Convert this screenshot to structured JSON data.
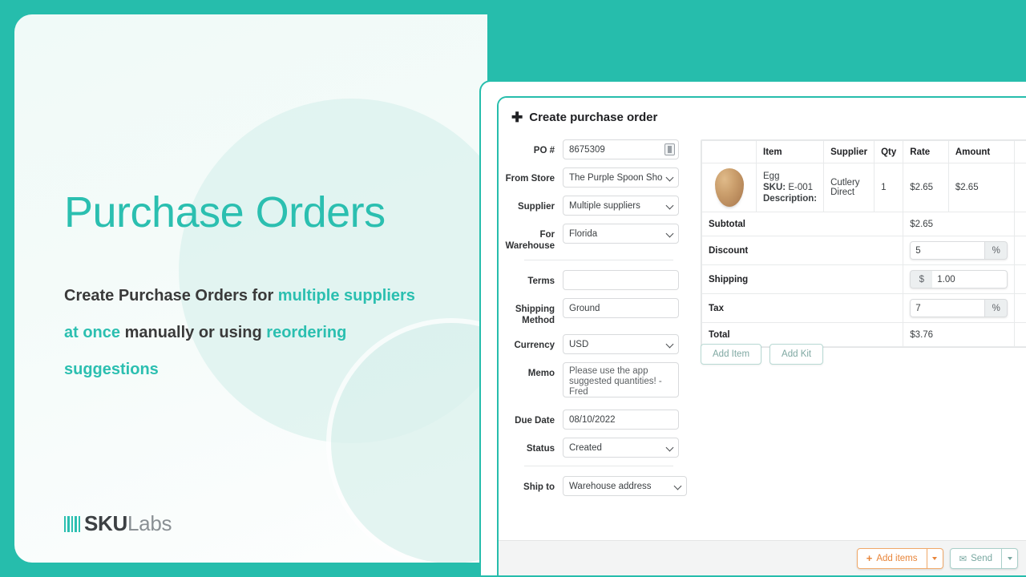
{
  "hero": {
    "title": "Purchase Orders",
    "subtitle_parts": [
      {
        "text": "Create Purchase Orders for ",
        "highlight": false
      },
      {
        "text": "multiple suppliers at once",
        "highlight": true
      },
      {
        "text": " manually or using ",
        "highlight": false
      },
      {
        "text": "reordering suggestions",
        "highlight": true
      }
    ],
    "logo": {
      "bold": "SKU",
      "light": "Labs"
    },
    "accent_color": "#2bbfb0",
    "frame_color": "#26bdac"
  },
  "app": {
    "header": {
      "plus": "✚",
      "title": "Create purchase order"
    },
    "form": {
      "po_number": {
        "label": "PO #",
        "value": "8675309",
        "icon": "document-icon"
      },
      "from_store": {
        "label": "From Store",
        "value": "The Purple Spoon Shop"
      },
      "supplier": {
        "label": "Supplier",
        "value": "Multiple suppliers"
      },
      "for_warehouse": {
        "label": "For Warehouse",
        "value": "Florida"
      },
      "terms": {
        "label": "Terms",
        "value": ""
      },
      "shipping_method": {
        "label": "Shipping Method",
        "value": "Ground"
      },
      "currency": {
        "label": "Currency",
        "value": "USD"
      },
      "memo": {
        "label": "Memo",
        "value": "Please use the app suggested quantities! - Fred"
      },
      "due_date": {
        "label": "Due Date",
        "value": "08/10/2022"
      },
      "status": {
        "label": "Status",
        "value": "Created"
      },
      "ship_to": {
        "label": "Ship to",
        "value": "Warehouse address"
      }
    },
    "items_table": {
      "columns": [
        "",
        "Item",
        "Supplier",
        "Qty",
        "Rate",
        "Amount",
        ""
      ],
      "rows": [
        {
          "image": "egg-thumbnail",
          "name": "Egg",
          "sku_label": "SKU:",
          "sku": "E-001",
          "description_label": "Description:",
          "description": "",
          "supplier": "Cutlery Direct",
          "qty": "1",
          "rate": "$2.65",
          "amount": "$2.65"
        }
      ],
      "totals": {
        "subtotal": {
          "label": "Subtotal",
          "value": "$2.65"
        },
        "discount": {
          "label": "Discount",
          "value": "5",
          "unit": "%"
        },
        "shipping": {
          "label": "Shipping",
          "value": "1.00",
          "unit": "$"
        },
        "tax": {
          "label": "Tax",
          "value": "7",
          "unit": "%"
        },
        "total": {
          "label": "Total",
          "value": "$3.76"
        }
      }
    },
    "add_buttons": {
      "add_item": "Add Item",
      "add_kit": "Add Kit"
    },
    "footer": {
      "add_items": {
        "label": "Add items",
        "plus": "+",
        "color": "#e8853a"
      },
      "send": {
        "label": "Send",
        "icon": "envelope-icon",
        "color": "#79a8a1"
      }
    }
  }
}
